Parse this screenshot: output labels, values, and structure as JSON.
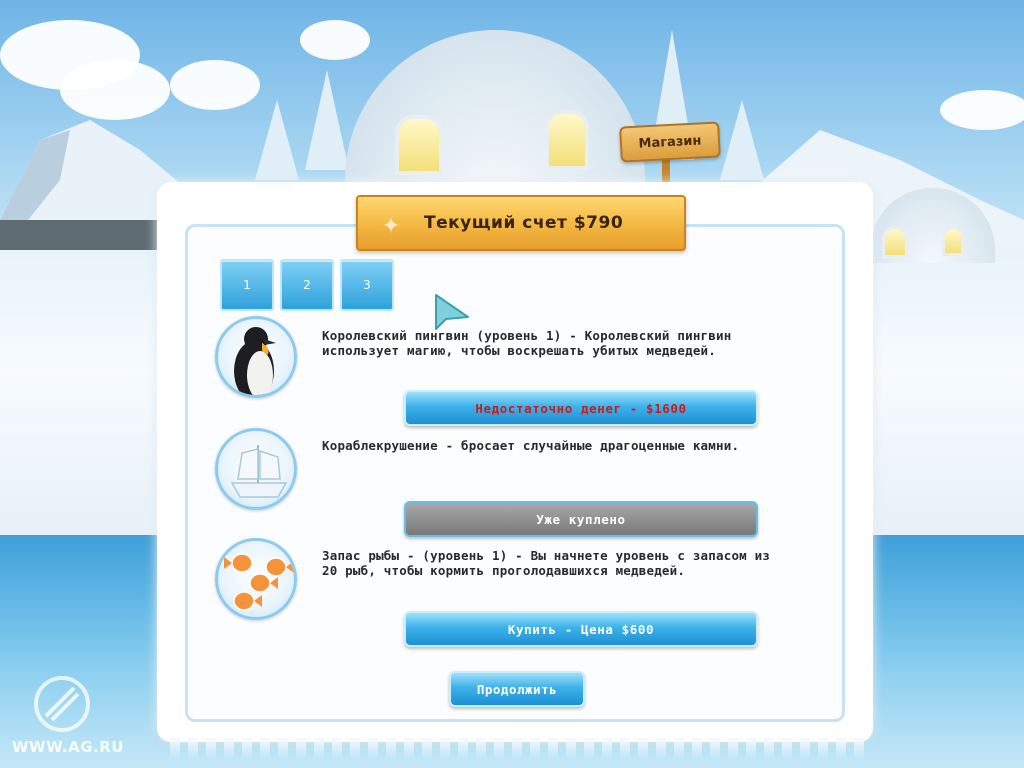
{
  "shop_sign": {
    "label": "Магазин"
  },
  "score": {
    "text": "Текущий счет $790"
  },
  "tabs": [
    {
      "label": "1"
    },
    {
      "label": "2"
    },
    {
      "label": "3"
    }
  ],
  "items": [
    {
      "icon": "penguin-icon",
      "description": "Королевский пингвин (уровень 1) - Королевский пингвин использует магию, чтобы воскрешать убитых медведей.",
      "button_label": "Недостаточно денег - $1600",
      "button_state": "insufficient"
    },
    {
      "icon": "ship-icon",
      "description": "Кораблекрушение - бросает случайные драгоценные камни.",
      "button_label": "Уже куплено",
      "button_state": "purchased"
    },
    {
      "icon": "fish-icon",
      "description": "Запас рыбы - (уровень 1) - Вы начнете уровень с запасом из 20 рыб, чтобы кормить проголодавшихся медведей.",
      "button_label": "Купить - Цена $600",
      "button_state": "available"
    }
  ],
  "continue_button": {
    "label": "Продолжить"
  },
  "watermark": {
    "text": "WWW.AG.RU"
  },
  "colors": {
    "button_blue": "#2fa1dc",
    "button_grey": "#8a8a8a",
    "insufficient_text": "#d21818",
    "banner_gold": "#f2b43f"
  }
}
